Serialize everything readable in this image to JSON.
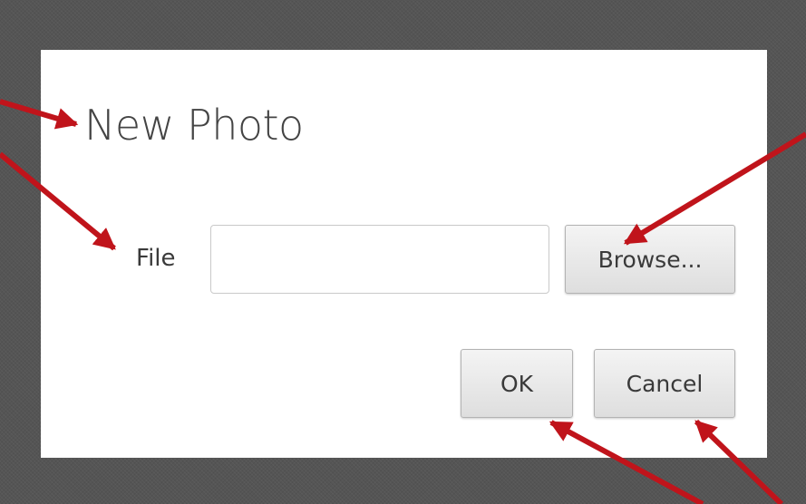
{
  "dialog": {
    "title": "New Photo",
    "file_label": "File",
    "file_value": "",
    "file_placeholder": "",
    "browse_label": "Browse...",
    "ok_label": "OK",
    "cancel_label": "Cancel"
  },
  "colors": {
    "backdrop": "#555555",
    "dialog_background": "#ffffff",
    "annotation_arrow": "#c0141b",
    "button_gradient_top": "#f4f4f4",
    "button_gradient_bottom": "#dedede"
  },
  "annotations": {
    "arrow_count": 5,
    "icon": "arrow-icon"
  }
}
